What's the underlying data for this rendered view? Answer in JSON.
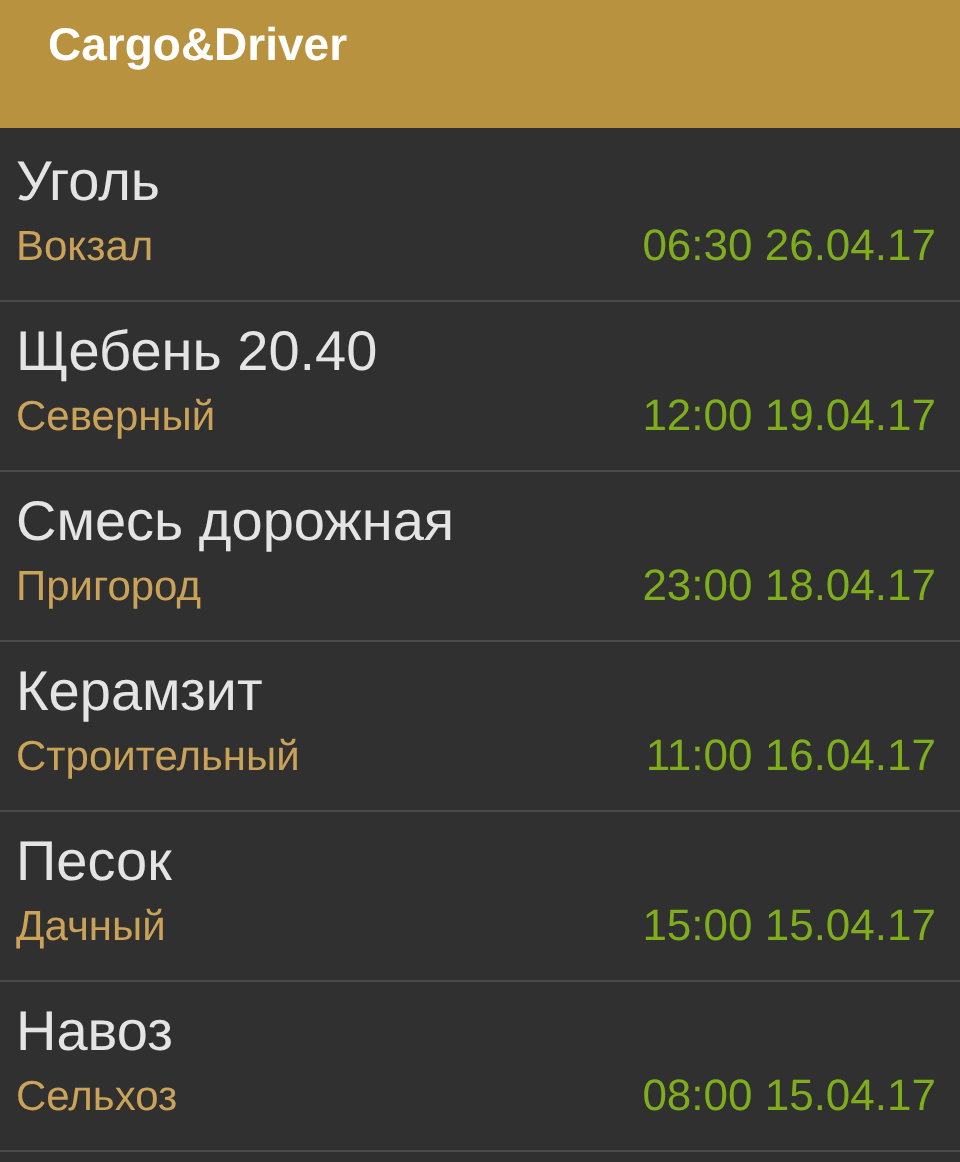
{
  "app_bar": {
    "title": "Cargo&Driver"
  },
  "orders": [
    {
      "cargo": "Уголь",
      "place": "Вокзал",
      "datetime": "06:30 26.04.17"
    },
    {
      "cargo": "Щебень 20.40",
      "place": "Северный",
      "datetime": "12:00 19.04.17"
    },
    {
      "cargo": "Смесь дорожная",
      "place": "Пригород",
      "datetime": "23:00 18.04.17"
    },
    {
      "cargo": "Керамзит",
      "place": "Строительный",
      "datetime": "11:00 16.04.17"
    },
    {
      "cargo": "Песок",
      "place": "Дачный",
      "datetime": "15:00 15.04.17"
    },
    {
      "cargo": "Навоз",
      "place": "Сельхоз",
      "datetime": "08:00 15.04.17"
    }
  ]
}
